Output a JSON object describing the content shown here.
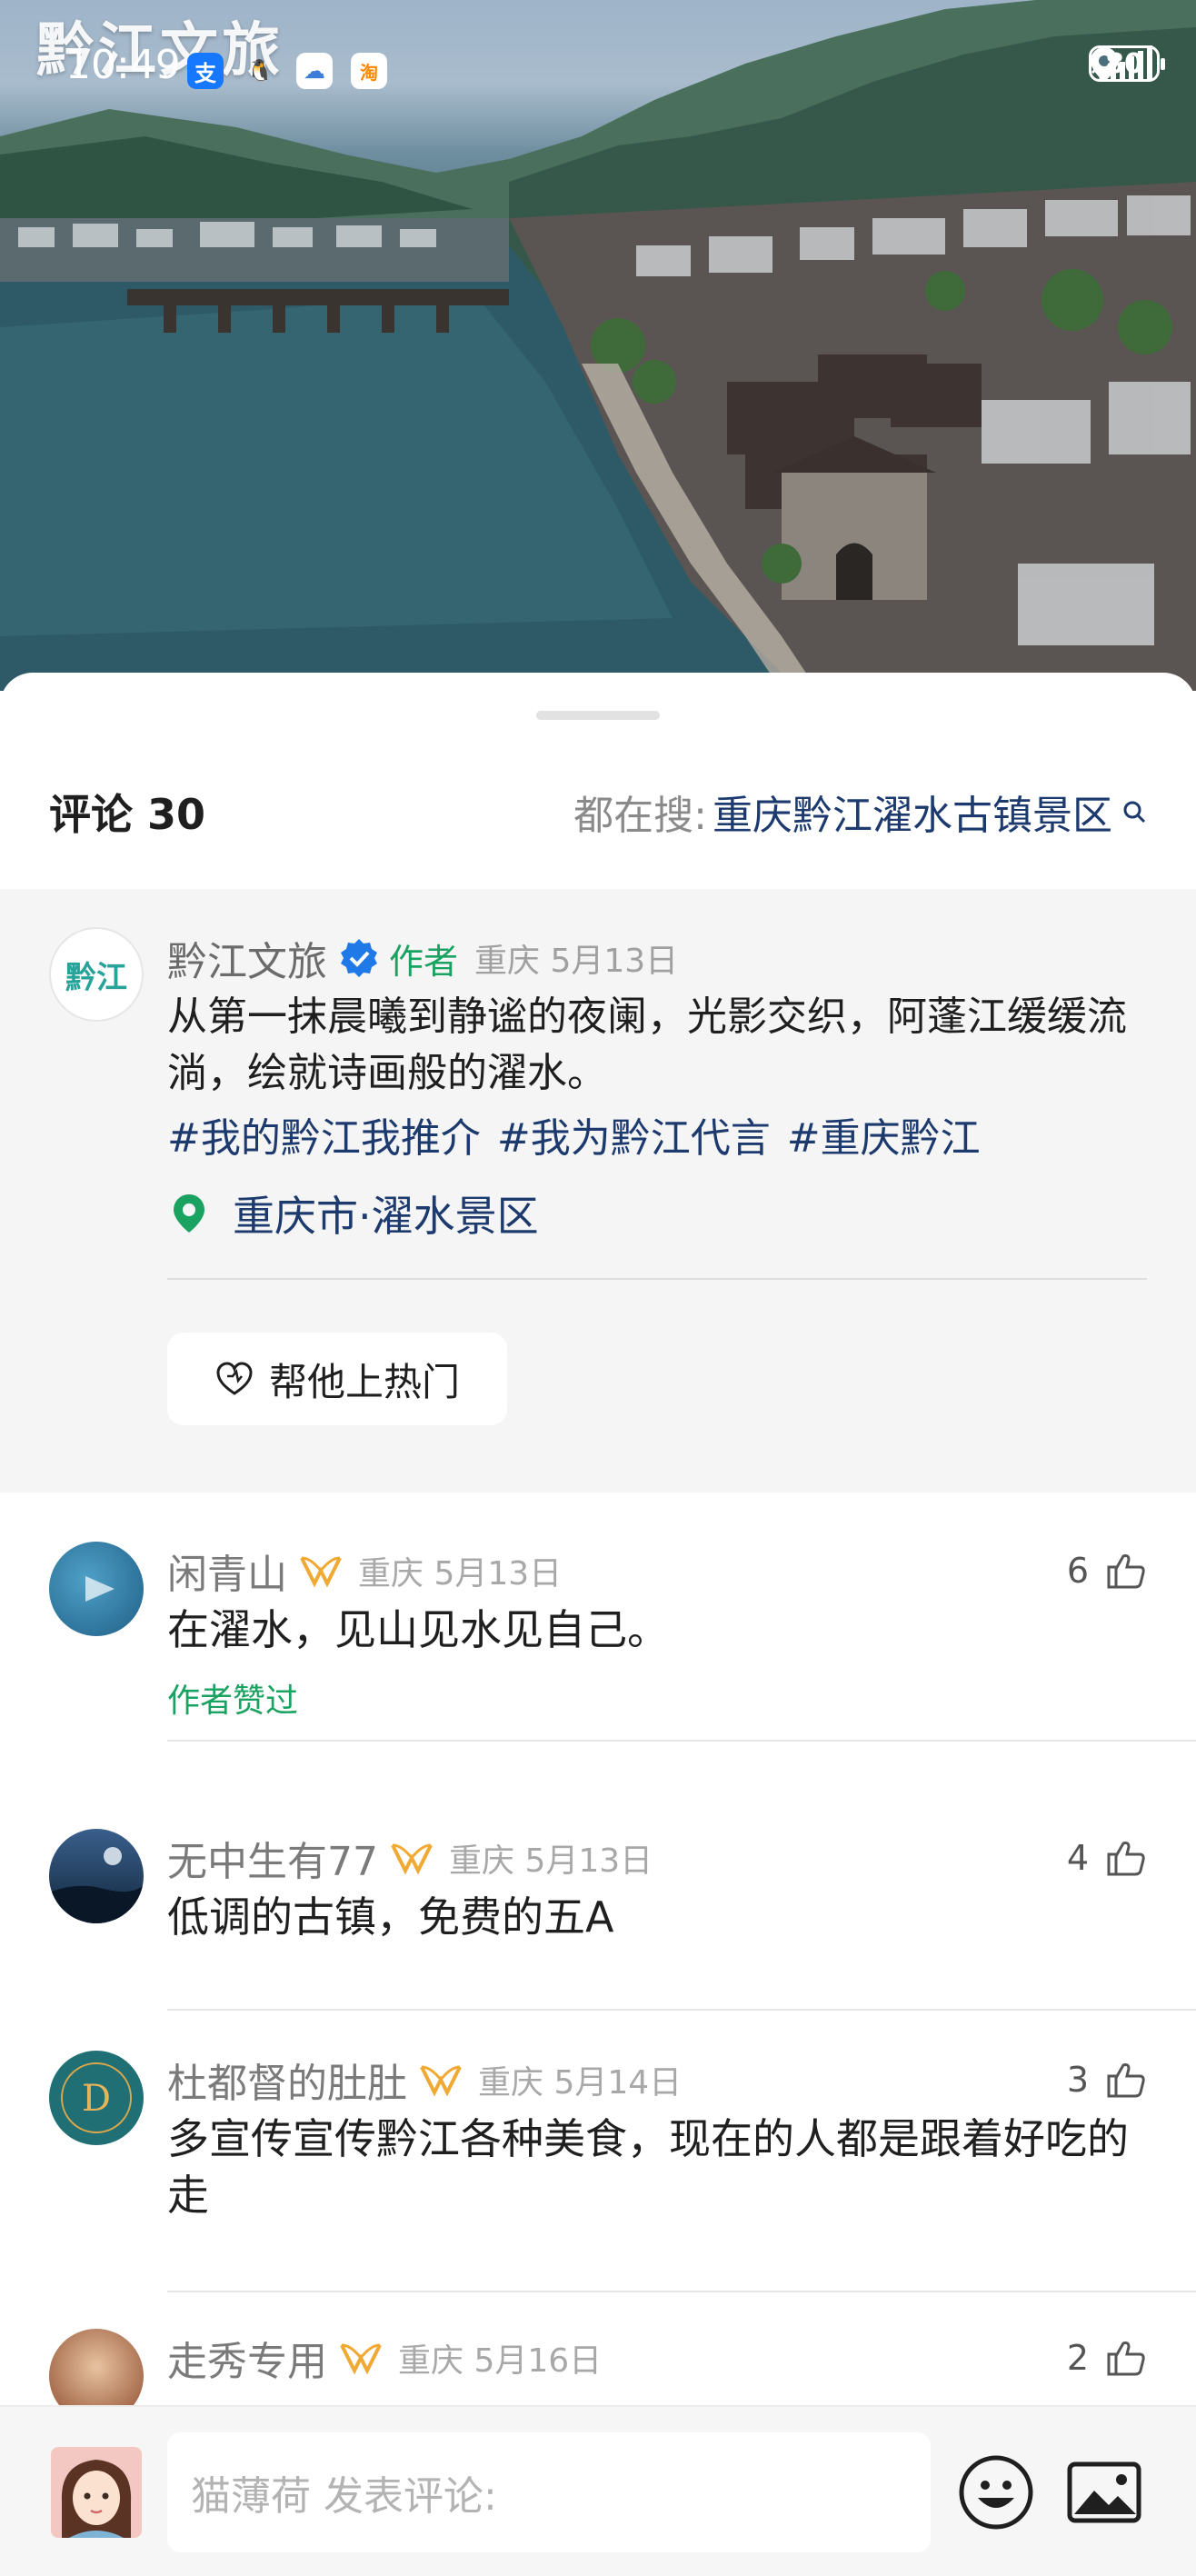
{
  "status_bar": {
    "time": "10:49",
    "battery": "80",
    "app_icons": [
      {
        "name": "alipay-icon",
        "glyph": "支",
        "color": "#1677ff"
      },
      {
        "name": "qq-icon",
        "glyph": "🐧",
        "color": "#ffffff"
      },
      {
        "name": "cloud-icon",
        "glyph": "☁",
        "color": "#3b7dd8"
      },
      {
        "name": "taobao-icon",
        "glyph": "淘",
        "color": "#ff8a00"
      }
    ]
  },
  "video": {
    "watermark": "黔江文旅"
  },
  "comments_header": {
    "title": "评论 30",
    "search_prefix": "都在搜:",
    "search_keyword": "重庆黔江濯水古镇景区"
  },
  "author_post": {
    "name": "黔江文旅",
    "author_tag": "作者",
    "location_date": "重庆  5月13日",
    "text": "从第一抹晨曦到静谧的夜阑，光影交织，阿蓬江缓缓流淌，绘就诗画般的濯水。",
    "hashtags": [
      "#我的黔江我推介",
      "#我为黔江代言",
      "#重庆黔江"
    ],
    "location": "重庆市·濯水景区",
    "boost_label": "帮他上热门",
    "avatar_logo": "黔江"
  },
  "comments": [
    {
      "name": "闲青山",
      "meta": "重庆  5月13日",
      "text": "在濯水，见山见水见自己。",
      "likes": "6",
      "author_liked": "作者赞过"
    },
    {
      "name": "无中生有77",
      "meta": "重庆  5月13日",
      "text": "低调的古镇，免费的五A",
      "likes": "4"
    },
    {
      "name": "杜都督的肚肚",
      "meta": "重庆  5月14日",
      "text": "多宣传宣传黔江各种美食，现在的人都是跟着好吃的走",
      "likes": "3"
    },
    {
      "name": "走秀专用",
      "meta": "重庆  5月16日",
      "text": "",
      "likes": "2"
    }
  ],
  "input_bar": {
    "placeholder": "猫薄荷 发表评论:"
  },
  "colors": {
    "link": "#1d3a6e",
    "author_green": "#1aa261",
    "vip_gold": "#f0a933",
    "verified_blue": "#1f7ae8"
  }
}
